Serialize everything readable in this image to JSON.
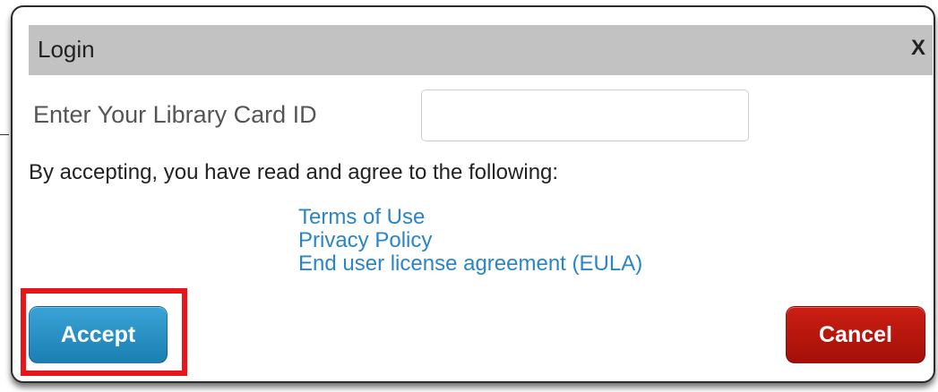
{
  "dialog": {
    "title": "Login",
    "close_label": "X",
    "card_label": "Enter Your Library Card ID",
    "card_input_value": "",
    "agreement_text": "By accepting, you have read and agree to the following:",
    "links": [
      "Terms of Use",
      "Privacy Policy",
      "End user license agreement (EULA)"
    ],
    "accept_label": "Accept",
    "cancel_label": "Cancel"
  },
  "colors": {
    "titlebar": "#c2c2c2",
    "link": "#2a85c6",
    "accept": "#1b7fb3",
    "cancel": "#a30f07",
    "highlight": "#e8151b"
  }
}
